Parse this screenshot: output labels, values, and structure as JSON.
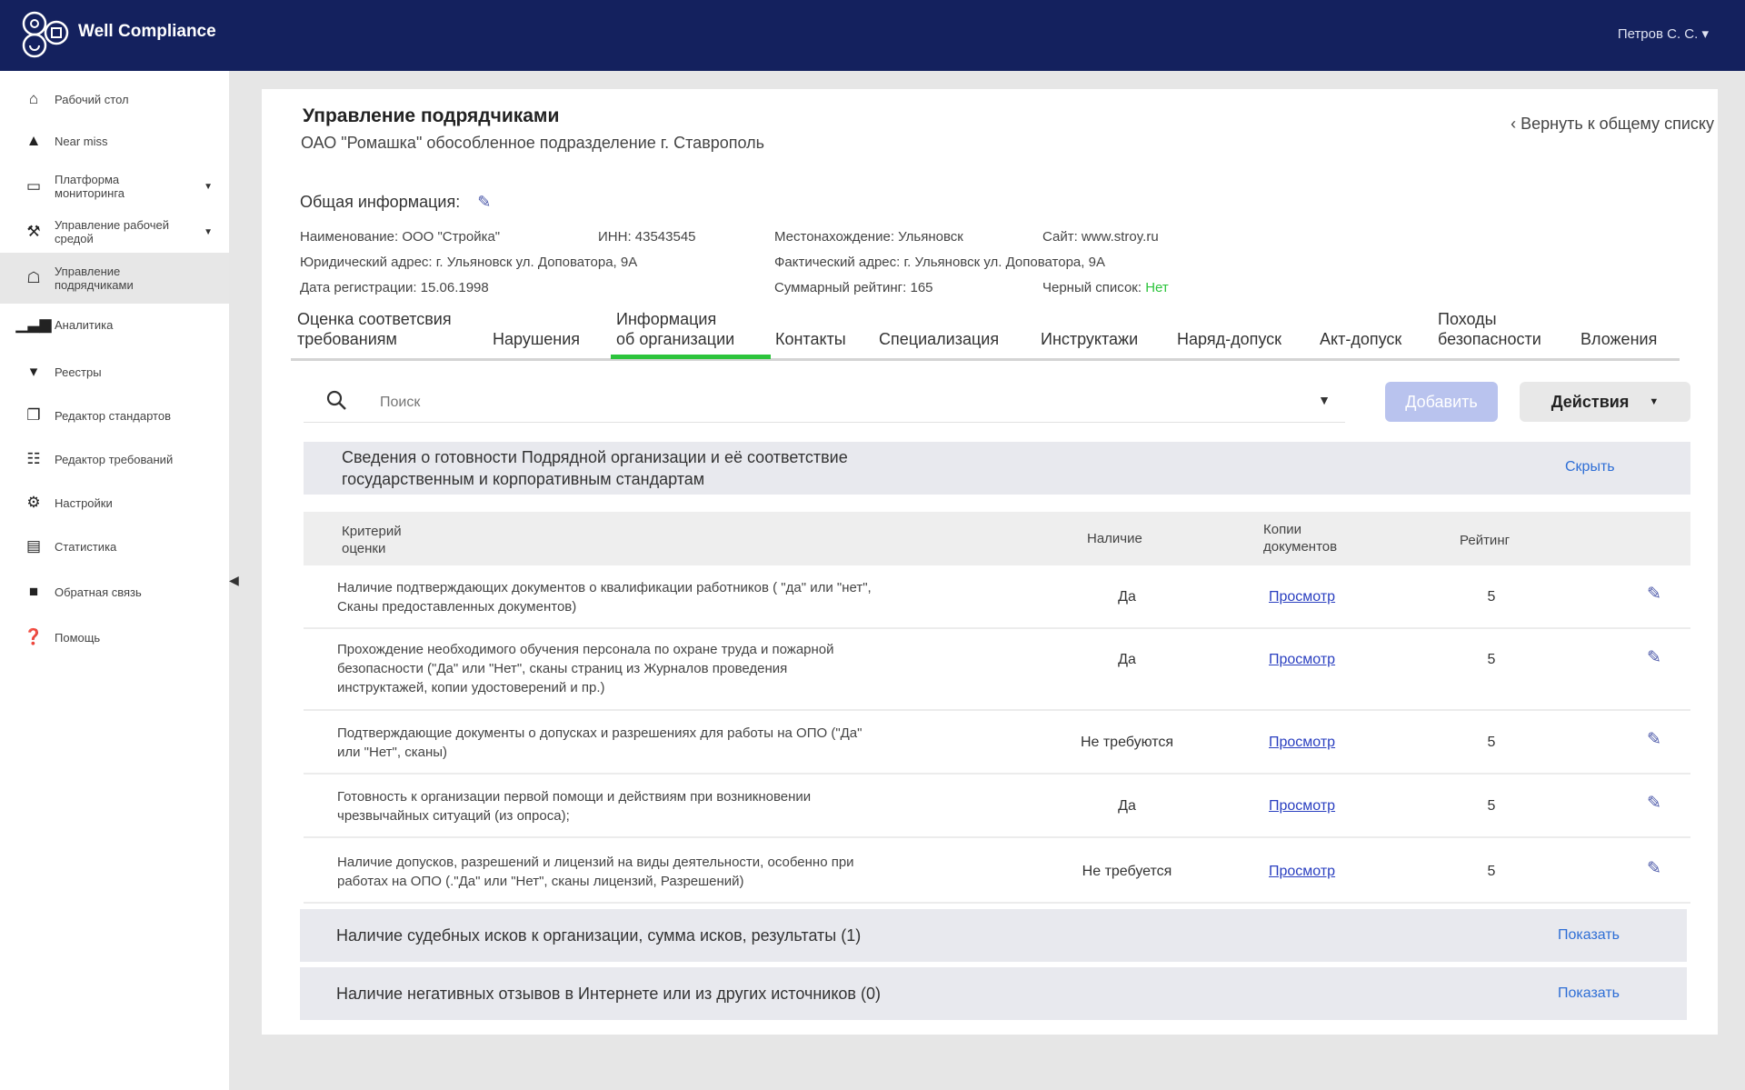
{
  "header": {
    "brand": "Well Compliance",
    "user": "Петров С. С.  ▾"
  },
  "sidebar": {
    "items": [
      {
        "label": "Рабочий стол"
      },
      {
        "label": "Near miss"
      },
      {
        "label": "Платформа мониторинга"
      },
      {
        "label": "Управление рабочей средой"
      },
      {
        "label": "Управление подрядчиками"
      },
      {
        "label": "Аналитика"
      },
      {
        "label": "Реестры"
      },
      {
        "label": "Редактор стандартов"
      },
      {
        "label": "Редактор требований"
      },
      {
        "label": "Настройки"
      },
      {
        "label": "Статистика"
      },
      {
        "label": "Обратная связь"
      },
      {
        "label": "Помощь"
      }
    ]
  },
  "page": {
    "title": "Управление подрядчиками",
    "subtitle": "ОАО \"Ромашка\" обособленное подразделение г. Ставрополь",
    "back": "Вернуть к общему списку"
  },
  "general": {
    "label": "Общая информация:",
    "name": "Наименование: ООО \"Стройка\"",
    "inn": "ИНН: 43543545",
    "location": "Местонахождение: Ульяновск",
    "site": "Сайт: www.stroy.ru",
    "legal_address": "Юридический адрес: г. Ульяновск ул. Доповатора, 9А",
    "actual_address": "Фактический адрес: г. Ульяновск ул. Доповатора, 9А",
    "reg_date": "Дата регистрации: 15.06.1998",
    "total_rating": "Суммарный рейтинг: 165",
    "blacklist_label": "Черный список:",
    "blacklist_value": "Нет"
  },
  "tabs": [
    {
      "line1": "Оценка соответсвия",
      "line2": "требованиям"
    },
    {
      "line1": "",
      "line2": "Нарушения"
    },
    {
      "line1": "Информация",
      "line2": "об организации"
    },
    {
      "line1": "",
      "line2": "Контакты"
    },
    {
      "line1": "",
      "line2": "Специализация"
    },
    {
      "line1": "",
      "line2": "Инструктажи"
    },
    {
      "line1": "",
      "line2": "Наряд-допуск"
    },
    {
      "line1": "",
      "line2": "Акт-допуск"
    },
    {
      "line1": "Походы",
      "line2": "безопасности"
    },
    {
      "line1": "",
      "line2": "Вложения"
    }
  ],
  "search": {
    "placeholder": "Поиск"
  },
  "buttons": {
    "add": "Добавить",
    "actions": "Действия"
  },
  "section1": {
    "line1": "Сведения о готовности Подрядной организации и её соответствие",
    "line2": "государственным и корпоративным стандартам",
    "toggle": "Скрыть"
  },
  "table": {
    "headers": {
      "criterion_l1": "Критерий",
      "criterion_l2": "оценки",
      "availability": "Наличие",
      "copies_l1": "Копии",
      "copies_l2": "документов",
      "rating": "Рейтинг"
    },
    "rows": [
      {
        "l1": "Наличие подтверждающих документов о квалификации работников ( \"да\" или \"нет\",",
        "l2": "Сканы предоставленных документов)",
        "l3": "",
        "availability": "Да",
        "copies": "Просмотр",
        "rating": "5"
      },
      {
        "l1": "Прохождение необходимого обучения персонала по охране труда и пожарной",
        "l2": "безопасности (\"Да\" или \"Нет\", сканы страниц из Журналов проведения",
        "l3": "инструктажей, копии удостоверений и пр.)",
        "availability": "Да",
        "copies": "Просмотр",
        "rating": "5"
      },
      {
        "l1": "Подтверждающие документы о допусках и разрешениях для работы на ОПО (\"Да\"",
        "l2": "или \"Нет\", сканы)",
        "l3": "",
        "availability": "Не требуются",
        "copies": "Просмотр",
        "rating": "5"
      },
      {
        "l1": "Готовность к организации первой помощи и действиям при возникновении",
        "l2": "чрезвычайных ситуаций (из опроса);",
        "l3": "",
        "availability": "Да",
        "copies": "Просмотр",
        "rating": "5"
      },
      {
        "l1": "Наличие допусков, разрешений и лицензий на виды деятельности, особенно при",
        "l2": "работах на ОПО (.\"Да\" или \"Нет\", сканы лицензий, Разрешений)",
        "l3": "",
        "availability": "Не требуется",
        "copies": "Просмотр",
        "rating": "5"
      }
    ]
  },
  "section2": {
    "title": "Наличие судебных исков к организации, сумма исков, результаты (1)",
    "toggle": "Показать"
  },
  "section3": {
    "title": "Наличие негативных отзывов в Интернете или из других источников (0)",
    "toggle": "Показать"
  },
  "colors": {
    "topbar": "#14215e",
    "accent_green": "#2cc43c",
    "link_blue": "#2f6fd6",
    "add_button": "#b9c3ee"
  }
}
